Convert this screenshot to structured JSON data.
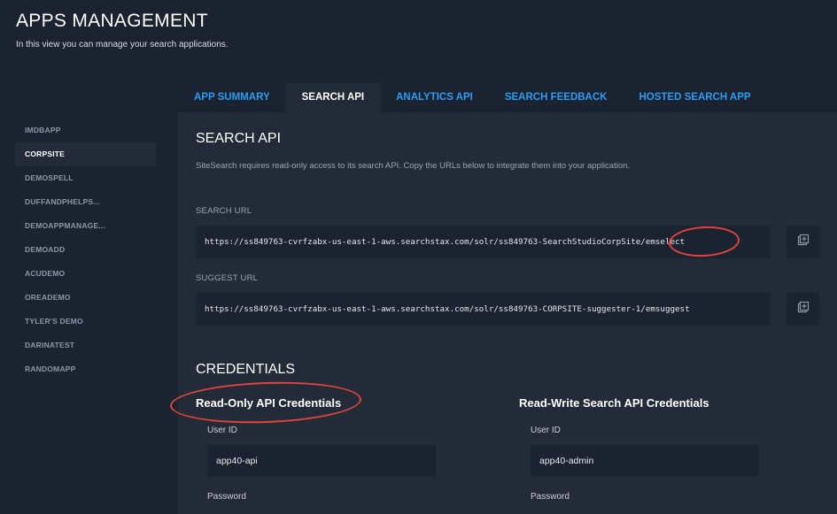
{
  "header": {
    "title": "APPS MANAGEMENT",
    "subtitle": "In this view you can manage your search applications."
  },
  "sidebar": {
    "items": [
      {
        "label": "IMDBAPP"
      },
      {
        "label": "CORPSITE",
        "active": true
      },
      {
        "label": "DEMOSPELL"
      },
      {
        "label": "DUFFANDPHELPS..."
      },
      {
        "label": "DEMOAPPMANAGE..."
      },
      {
        "label": "DEMOADD"
      },
      {
        "label": "ACUDEMO"
      },
      {
        "label": "OREADEMO"
      },
      {
        "label": "TYLER'S DEMO"
      },
      {
        "label": "DARINATEST"
      },
      {
        "label": "RANDOMAPP"
      }
    ]
  },
  "tabs": [
    {
      "label": "APP SUMMARY"
    },
    {
      "label": "SEARCH API",
      "active": true
    },
    {
      "label": "ANALYTICS API"
    },
    {
      "label": "SEARCH FEEDBACK"
    },
    {
      "label": "HOSTED SEARCH APP"
    }
  ],
  "search_api": {
    "title": "SEARCH API",
    "description": "SiteSearch requires read-only access to its search API. Copy the URLs below to integrate them into your application.",
    "search_url_label": "SEARCH URL",
    "search_url": "https://ss849763-cvrfzabx-us-east-1-aws.searchstax.com/solr/ss849763-SearchStudioCorpSite/emselect",
    "suggest_url_label": "SUGGEST URL",
    "suggest_url": "https://ss849763-cvrfzabx-us-east-1-aws.searchstax.com/solr/ss849763-CORPSITE-suggester-1/emsuggest"
  },
  "credentials": {
    "title": "CREDENTIALS",
    "read_only": {
      "heading": "Read-Only API Credentials",
      "user_id_label": "User ID",
      "user_id": "app40-api",
      "password_label": "Password"
    },
    "read_write": {
      "heading": "Read-Write Search API Credentials",
      "user_id_label": "User ID",
      "user_id": "app40-admin",
      "password_label": "Password"
    }
  },
  "colors": {
    "background": "#1b2230",
    "panel": "#232b39",
    "accent": "#2a9df4",
    "highlight": "#e0443e"
  },
  "icons": {
    "copy": "copy-icon"
  }
}
